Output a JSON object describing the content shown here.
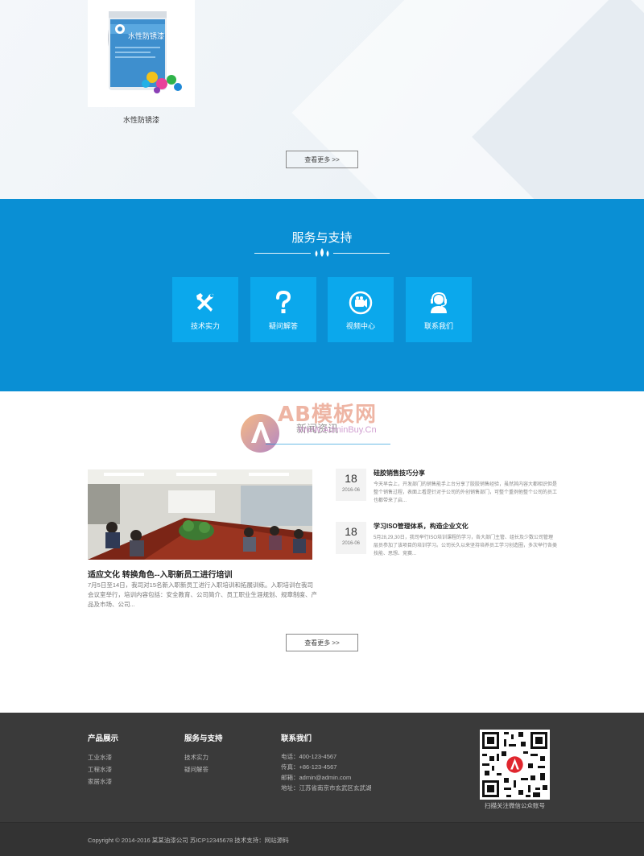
{
  "products": {
    "item_name": "水性防锈漆",
    "can_label": "水性防锈漆",
    "more_label": "查看更多 >>"
  },
  "services": {
    "title": "服务与支持",
    "items": [
      {
        "label": "技术实力",
        "icon": "tools-icon"
      },
      {
        "label": "疑问解答",
        "icon": "question-icon"
      },
      {
        "label": "视频中心",
        "icon": "video-icon"
      },
      {
        "label": "联系我们",
        "icon": "headset-icon"
      }
    ]
  },
  "news": {
    "title": "新闻资讯",
    "watermark": {
      "brand": "AB模板网",
      "url": "WwW.AdminBuy.Cn"
    },
    "main": {
      "title": "适应文化 转换角色--入职新员工进行培训",
      "desc": "7月5日至14日，我司对15名新入职新员工进行入职培训和拓展训练。入职培训在我司会议室举行，培训内容包括：安全教育、公司简介、员工职业生涯规划、规章制度、产品及市场、公司..."
    },
    "items": [
      {
        "day": "18",
        "ym": "2016-06",
        "title": "硅胶销售技巧分享",
        "desc": "今天早会上，开发部门的销售能手上台分享了胶胶销售经验，虽然其内容大都相识但是整个销售过程，表面上看是针对于公司的外创销售部门，可整个重例他整个公司的员工也都带来了启..."
      },
      {
        "day": "18",
        "ym": "2016-06",
        "title": "学习ISO管理体系，构造企业文化",
        "desc": "5月28,29,30日，我司举行ISO培训课程的学习，各大部门主管、组长及少数公司管理层员参加了该项目的培训学习。公司长久以来坚持培养员工学习创造圈，多次举行各类技能、思想、竞赛..."
      }
    ],
    "more_label": "查看更多 >>"
  },
  "footer": {
    "col1": {
      "title": "产品展示",
      "links": [
        "工业水漆",
        "工程水漆",
        "家居水漆"
      ]
    },
    "col2": {
      "title": "服务与支持",
      "links": [
        "技术实力",
        "疑问解答"
      ]
    },
    "col3": {
      "title": "联系我们",
      "lines": [
        "电话：400-123-4567",
        "传真：+86-123-4567",
        "邮箱：admin@admin.com",
        "地址：江苏省南京市玄武区玄武湖"
      ]
    },
    "qr_caption": "扫描关注微信公众账号",
    "copyright": "Copyright © 2014-2016 某某油漆公司   苏ICP12345678   技术支持：网站源码"
  },
  "colors": {
    "brand_blue": "#0a8fd4",
    "tile_blue": "#0ba8ec",
    "footer_dark": "#3a3a3a"
  }
}
